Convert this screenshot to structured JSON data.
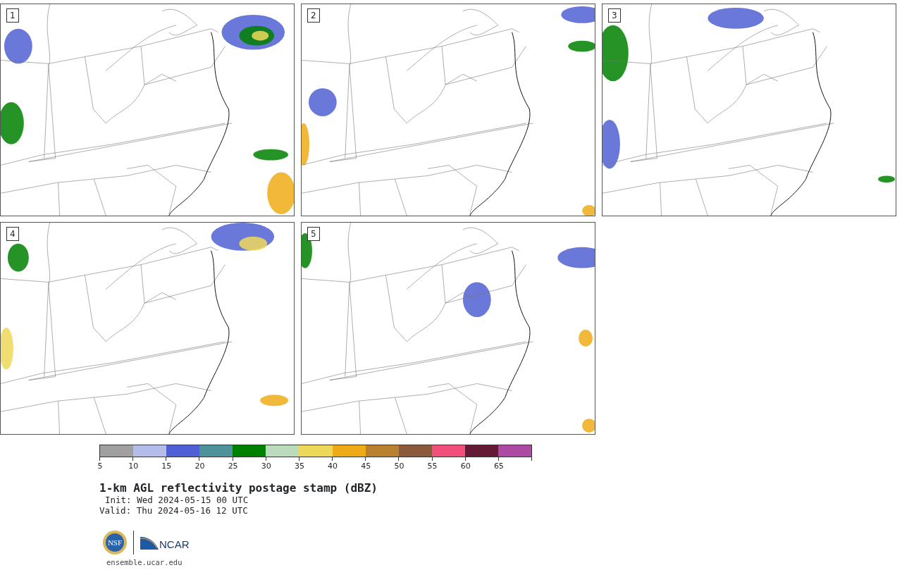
{
  "panels": [
    {
      "label": "1"
    },
    {
      "label": "2"
    },
    {
      "label": "3"
    },
    {
      "label": "4"
    },
    {
      "label": "5"
    }
  ],
  "colorbar": {
    "segments": [
      {
        "color": "#a0a0a0"
      },
      {
        "color": "#b4bde9"
      },
      {
        "color": "#5060d4"
      },
      {
        "color": "#4e9399"
      },
      {
        "color": "#008000"
      },
      {
        "color": "#bcdbbc"
      },
      {
        "color": "#eed85a"
      },
      {
        "color": "#efab17"
      },
      {
        "color": "#b8812f"
      },
      {
        "color": "#8b5a3c"
      },
      {
        "color": "#f34f7b"
      },
      {
        "color": "#631a35"
      },
      {
        "color": "#ac4aa4"
      }
    ],
    "ticks": [
      "5",
      "10",
      "15",
      "20",
      "25",
      "30",
      "35",
      "40",
      "45",
      "50",
      "55",
      "60",
      "65"
    ]
  },
  "title": "1-km AGL reflectivity postage stamp (dBZ)",
  "init": "Init: Wed 2024-05-15 00 UTC",
  "valid": "Valid: Thu 2024-05-16 12 UTC",
  "logos": {
    "nsf": "NSF",
    "ncar": "NCAR"
  },
  "url": "ensemble.ucar.edu"
}
